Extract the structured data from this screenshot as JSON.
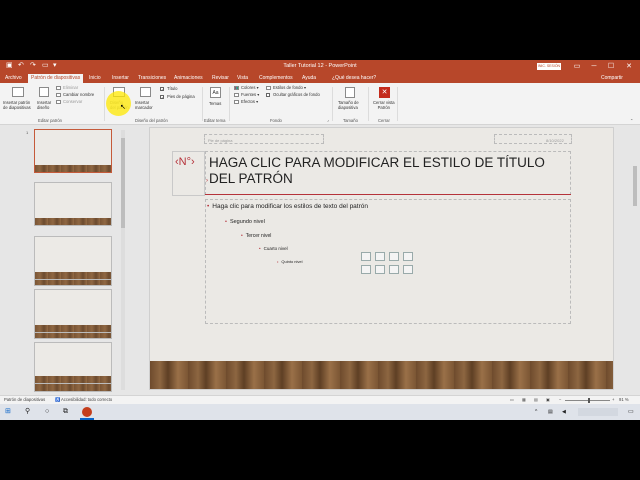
{
  "window": {
    "title": "Taller Tutorial 12  -  PowerPoint",
    "signin": "INIC. SESIÓN",
    "controls": {
      "ribbon_display": "▭",
      "minimize": "─",
      "maximize": "☐",
      "close": "✕"
    },
    "quick_access": [
      "save-icon",
      "undo-icon",
      "redo-icon",
      "start-presentation-icon",
      "customize-icon"
    ]
  },
  "tabs": [
    {
      "label": "Archivo"
    },
    {
      "label": "Patrón de diapositivas",
      "active": true
    },
    {
      "label": "Inicio"
    },
    {
      "label": "Insertar"
    },
    {
      "label": "Transiciones"
    },
    {
      "label": "Animaciones"
    },
    {
      "label": "Revisar"
    },
    {
      "label": "Vista"
    },
    {
      "label": "Complementos"
    },
    {
      "label": "Ayuda"
    },
    {
      "label": "¿Qué desea hacer?"
    }
  ],
  "share": "Compartir",
  "ribbon": {
    "editar_patron": {
      "insert_master": [
        "Insertar patrón",
        "de diapositivas"
      ],
      "insert_layout": [
        "Insertar",
        "diseño"
      ],
      "delete": "Eliminar",
      "rename": "Cambiar nombre",
      "preserve": "Conservar",
      "label": "Editar patrón"
    },
    "diseno_patron": {
      "master_layout": [
        "Diseño",
        "del patrón"
      ],
      "insert_placeholder": [
        "Insertar",
        "marcador"
      ],
      "title": "Título",
      "footers": "Pies de página",
      "label": "Diseño del patrón"
    },
    "editar_tema": {
      "themes": "Temas",
      "label": "Editar tema"
    },
    "fondo": {
      "colors": "Colores",
      "fonts": "Fuentes",
      "effects": "Efectos",
      "bg_styles": "Estilos de fondo",
      "hide_bg": "Ocultar gráficos de fondo",
      "label": "Fondo"
    },
    "tamano": {
      "slide_size": [
        "Tamaño de",
        "diapositiva"
      ],
      "label": "Tamaño"
    },
    "cerrar": {
      "close_view": [
        "Cerrar vista",
        "Patrón"
      ],
      "label": "Cerrar"
    }
  },
  "thumbnails": {
    "number": "1"
  },
  "slide": {
    "footer_left": "Pie de página",
    "footer_right": "8/10/2022",
    "num": "‹N°›",
    "title": "HAGA CLIC PARA MODIFICAR EL ESTILO DE TÍTULO DEL PATRÓN",
    "levels": [
      "Haga clic para modificar los estilos de texto del patrón",
      "Segundo nivel",
      "Tercer nivel",
      "Cuarto nivel",
      "Quinto nivel"
    ]
  },
  "status": {
    "view": "Patrón de diapositivas",
    "accessibility": "Accesibilidad: todo correcto",
    "zoom": "91 %"
  },
  "colors": {
    "accent": "#b7472a",
    "title_red": "#b5323a"
  }
}
